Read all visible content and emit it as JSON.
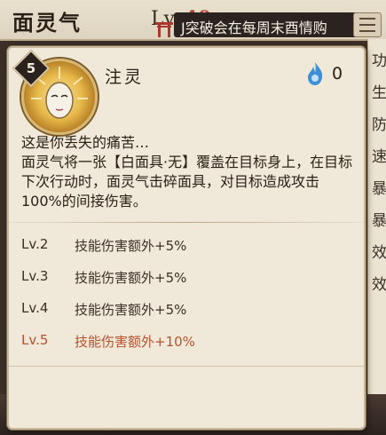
{
  "header": {
    "character_name": "面灵气",
    "level_label": "Lv.",
    "level_value": "40",
    "marquee_text": "J突破会在每周末酉情购"
  },
  "right_panel_chars": [
    "功",
    "生",
    "防",
    "速",
    "暴",
    "暴",
    "效",
    "效"
  ],
  "skill": {
    "cost": "5",
    "name": "注灵",
    "orb_count": "0",
    "description": [
      "这是你丢失的痛苦…",
      "面灵气将一张【白面具·无】覆盖在目标身上，在目标下次行动时，面灵气击碎面具，对目标造成攻击100%的间接伤害。"
    ],
    "levels": [
      {
        "level": "Lv.2",
        "effect": "技能伤害额外+5%"
      },
      {
        "level": "Lv.3",
        "effect": "技能伤害额外+5%"
      },
      {
        "level": "Lv.4",
        "effect": "技能伤害额外+5%"
      },
      {
        "level": "Lv.5",
        "effect": "技能伤害额外+10%"
      }
    ]
  },
  "colors": {
    "card_bg": "#f0e8d8",
    "max_level_text": "#b4532f",
    "orb_blue": "#3e8fd6"
  }
}
